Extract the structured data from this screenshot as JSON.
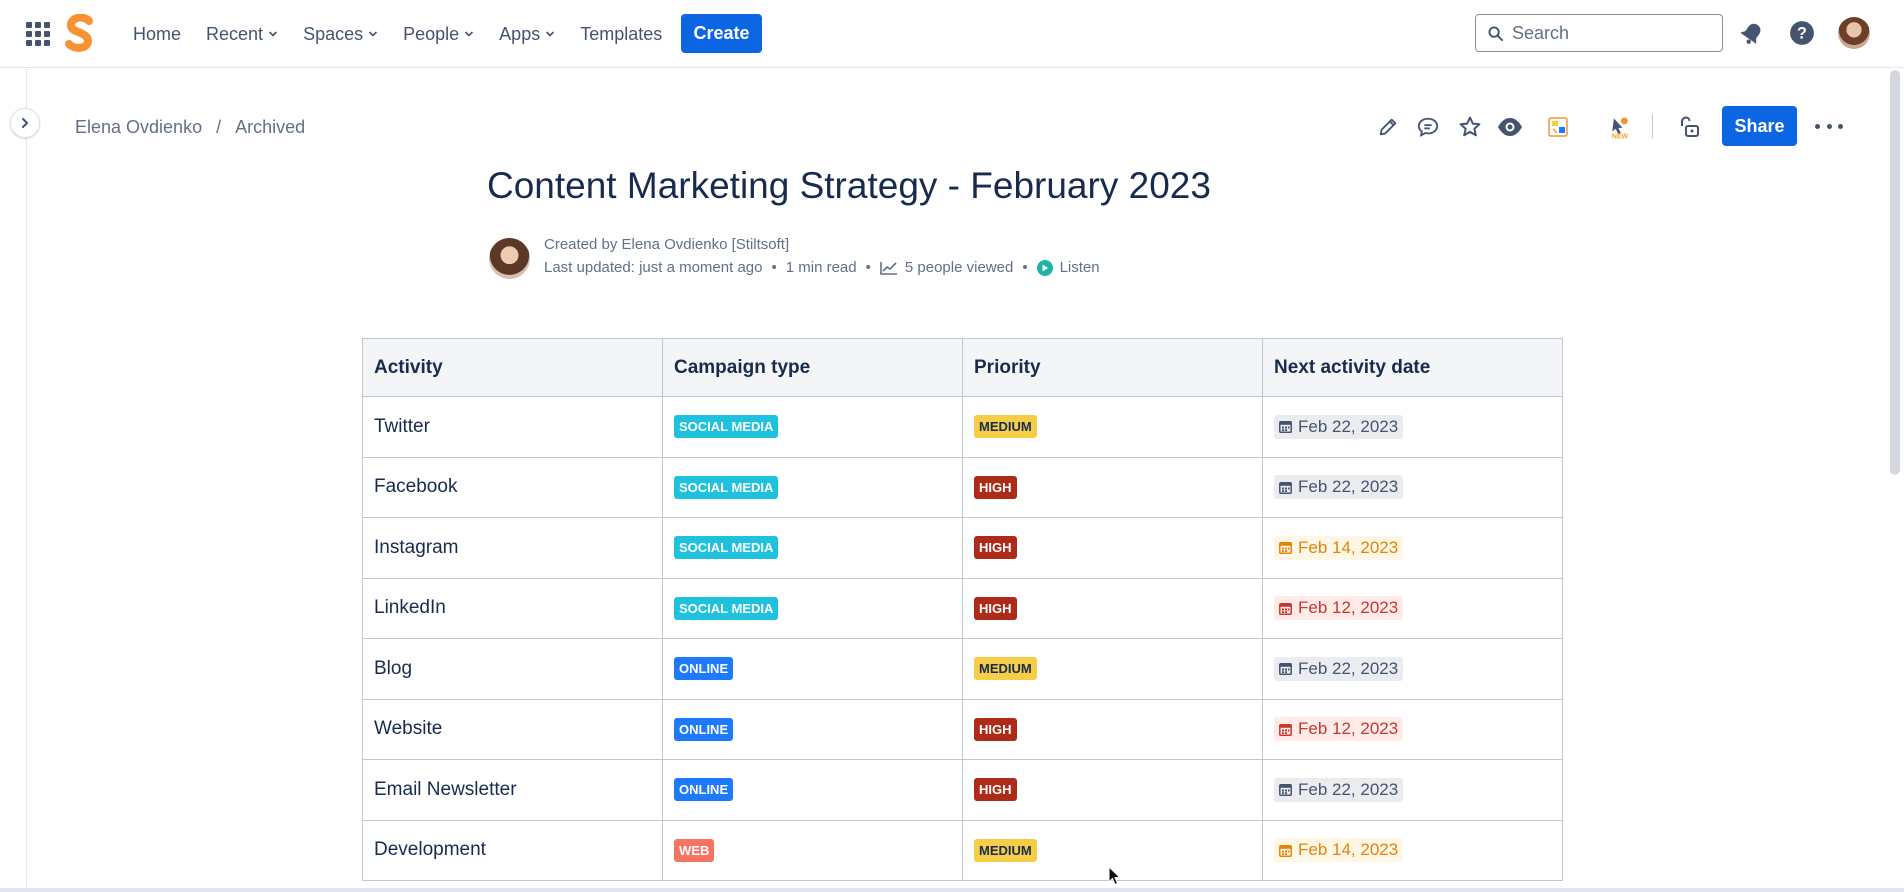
{
  "nav": {
    "items": [
      {
        "label": "Home",
        "dropdown": false
      },
      {
        "label": "Recent",
        "dropdown": true
      },
      {
        "label": "Spaces",
        "dropdown": true
      },
      {
        "label": "People",
        "dropdown": true
      },
      {
        "label": "Apps",
        "dropdown": true
      },
      {
        "label": "Templates",
        "dropdown": false
      }
    ],
    "create_label": "Create",
    "search_placeholder": "Search"
  },
  "breadcrumb": {
    "items": [
      "Elena Ovdienko",
      "Archived"
    ],
    "separator": "/"
  },
  "toolbar": {
    "share_label": "Share",
    "icons": [
      "edit-icon",
      "comment-icon",
      "star-icon",
      "watch-icon",
      "app-icon",
      "new-app-icon",
      "restrictions-icon",
      "more-icon"
    ]
  },
  "page": {
    "title": "Content Marketing Strategy - February 2023",
    "byline": {
      "created": "Created by Elena Ovdienko [Stiltsoft]",
      "updated": "Last updated: just a moment ago",
      "read_time": "1 min read",
      "viewed": "5 people viewed",
      "listen": "Listen"
    }
  },
  "table": {
    "headers": [
      "Activity",
      "Campaign type",
      "Priority",
      "Next activity date"
    ],
    "rows": [
      {
        "activity": "Twitter",
        "campaign": "SOCIAL MEDIA",
        "priority": "MEDIUM",
        "date": "Feb 22, 2023",
        "date_status": "normal"
      },
      {
        "activity": "Facebook",
        "campaign": "SOCIAL MEDIA",
        "priority": "HIGH",
        "date": "Feb 22, 2023",
        "date_status": "normal"
      },
      {
        "activity": "Instagram",
        "campaign": "SOCIAL MEDIA",
        "priority": "HIGH",
        "date": "Feb 14, 2023",
        "date_status": "warn"
      },
      {
        "activity": "LinkedIn",
        "campaign": "SOCIAL MEDIA",
        "priority": "HIGH",
        "date": "Feb 12, 2023",
        "date_status": "danger"
      },
      {
        "activity": "Blog",
        "campaign": "ONLINE",
        "priority": "MEDIUM",
        "date": "Feb 22, 2023",
        "date_status": "normal"
      },
      {
        "activity": "Website",
        "campaign": "ONLINE",
        "priority": "HIGH",
        "date": "Feb 12, 2023",
        "date_status": "danger"
      },
      {
        "activity": "Email Newsletter",
        "campaign": "ONLINE",
        "priority": "HIGH",
        "date": "Feb 22, 2023",
        "date_status": "normal"
      },
      {
        "activity": "Development",
        "campaign": "WEB",
        "priority": "MEDIUM",
        "date": "Feb 14, 2023",
        "date_status": "warn"
      }
    ]
  },
  "colors": {
    "brand_blue": "#0c66e4",
    "logo_orange": "#f79232",
    "social_media": "#1fc2de",
    "online": "#1d7afc",
    "web": "#f87462",
    "medium": "#f5cd47",
    "high": "#ae2a19"
  }
}
